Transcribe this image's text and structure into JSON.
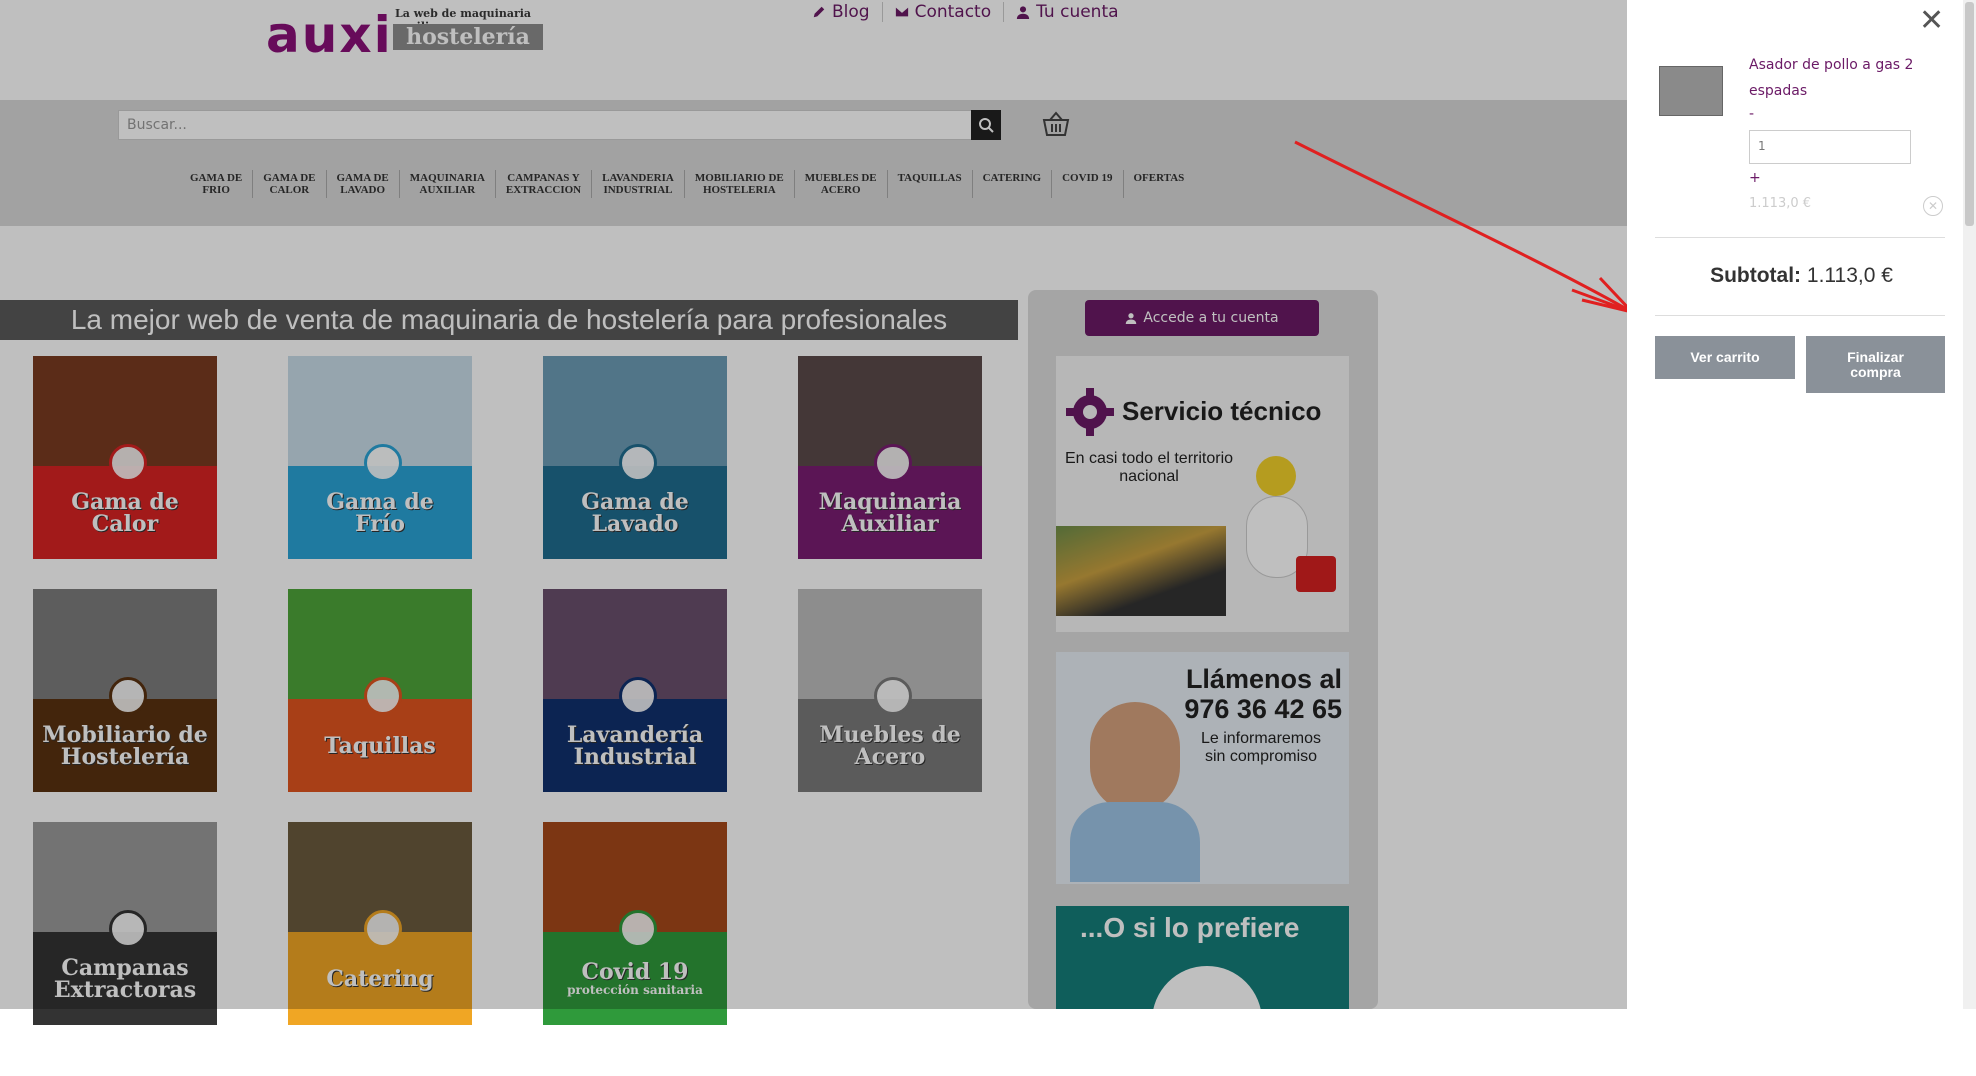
{
  "logo": {
    "brand": "auxi",
    "tagline": "La web de maquinaria auxiliar",
    "brand2": "hostelería"
  },
  "topnav": [
    {
      "label": "Blog",
      "icon": "pencil-icon"
    },
    {
      "label": "Contacto",
      "icon": "envelope-icon"
    },
    {
      "label": "Tu cuenta",
      "icon": "user-icon"
    }
  ],
  "search": {
    "placeholder": "Buscar..."
  },
  "categories": [
    "GAMA DE\nFRIO",
    "GAMA DE\nCALOR",
    "GAMA DE\nLAVADO",
    "MAQUINARIA\nAUXILIAR",
    "CAMPANAS Y\nEXTRACCION",
    "LAVANDERIA\nINDUSTRIAL",
    "MOBILIARIO DE\nHOSTELERIA",
    "MUEBLES DE\nACERO",
    "TAQUILLAS",
    "CATERING",
    "COVID 19",
    "OFERTAS"
  ],
  "banner": "La mejor web de venta de maquinaria de hostelería para profesionales",
  "tiles": [
    {
      "label": "Gama de\nCalor",
      "color": "#d92323",
      "img": "#7a3b20"
    },
    {
      "label": "Gama de\nFrío",
      "color": "#2aa3d6",
      "img": "#c9dde8"
    },
    {
      "label": "Gama de\nLavado",
      "color": "#1f6c8f",
      "img": "#6d9db6"
    },
    {
      "label": "Maquinaria\nAuxiliar",
      "color": "#7a1c72",
      "img": "#5b4a4a"
    },
    {
      "label": "Mobiliario de\nHostelería",
      "color": "#5a3210",
      "img": "#7d7d7d"
    },
    {
      "label": "Taquillas",
      "color": "#e0541f",
      "img": "#4ea43a"
    },
    {
      "label": "Lavandería\nIndustrial",
      "color": "#10316e",
      "img": "#6a4f6d"
    },
    {
      "label": "Muebles de\nAcero",
      "color": "#7a7a7a",
      "img": "#bdbdbd"
    },
    {
      "label": "Campanas\nExtractoras",
      "color": "#333333",
      "img": "#9a9a9a"
    },
    {
      "label": "Catering",
      "color": "#f0a624",
      "img": "#6b5b3e"
    },
    {
      "label": "Covid 19",
      "sub": "protección sanitaria",
      "color": "#2f9a3b",
      "img": "#a6491a"
    }
  ],
  "sidebar": {
    "account_button": "Accede a tu cuenta",
    "promo1": {
      "title": "Servicio técnico",
      "text": "En casi todo el territorio\nnacional"
    },
    "promo2": {
      "title": "Llámenos al\n976 36 42 65",
      "text": "Le informaremos\nsin compromiso"
    },
    "promo3": {
      "title": "...O si lo prefiere"
    }
  },
  "cart": {
    "product_name": "Asador de pollo a gas 2 espadas",
    "minus": "-",
    "quantity": "1",
    "plus": "+",
    "price": "1.113,0 €",
    "subtotal_label": "Subtotal:",
    "subtotal_value": "1.113,0 €",
    "view_cart": "Ver carrito",
    "checkout": "Finalizar compra"
  },
  "colors": {
    "brand": "#6b1a66",
    "arrow": "#e02020"
  }
}
